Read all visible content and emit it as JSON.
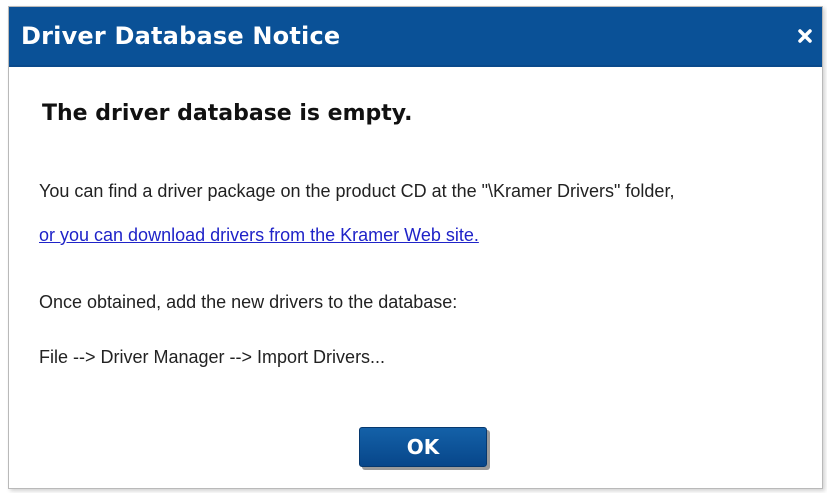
{
  "dialog": {
    "title": "Driver Database Notice",
    "close_icon": "close-icon",
    "heading": "The driver database is empty.",
    "message_line1": "You can find a driver package on the product CD at the \"\\Kramer Drivers\" folder,",
    "download_link": "or you can download drivers from the Kramer Web site.",
    "message_line3": "Once obtained, add the new drivers to the database:",
    "message_line4": "File --> Driver Manager --> Import Drivers...",
    "ok_label": "OK"
  },
  "colors": {
    "titlebar": "#0a5197",
    "link": "#1f23c8",
    "button": "#07468a"
  }
}
